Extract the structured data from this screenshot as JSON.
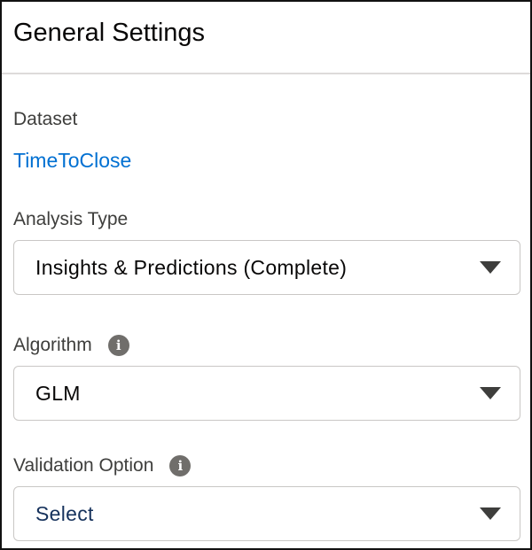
{
  "header": {
    "title": "General Settings"
  },
  "dataset": {
    "label": "Dataset",
    "value": "TimeToClose"
  },
  "analysis_type": {
    "label": "Analysis Type",
    "selected": "Insights & Predictions (Complete)"
  },
  "algorithm": {
    "label": "Algorithm",
    "selected": "GLM"
  },
  "validation_option": {
    "label": "Validation Option",
    "selected": "Select"
  },
  "icons": {
    "info": "info-icon",
    "caret": "chevron-down-icon"
  },
  "colors": {
    "link": "#0070d2",
    "label": "#3e3e3c",
    "border": "#c9c7c5",
    "info_icon_bg": "#706e6b"
  }
}
